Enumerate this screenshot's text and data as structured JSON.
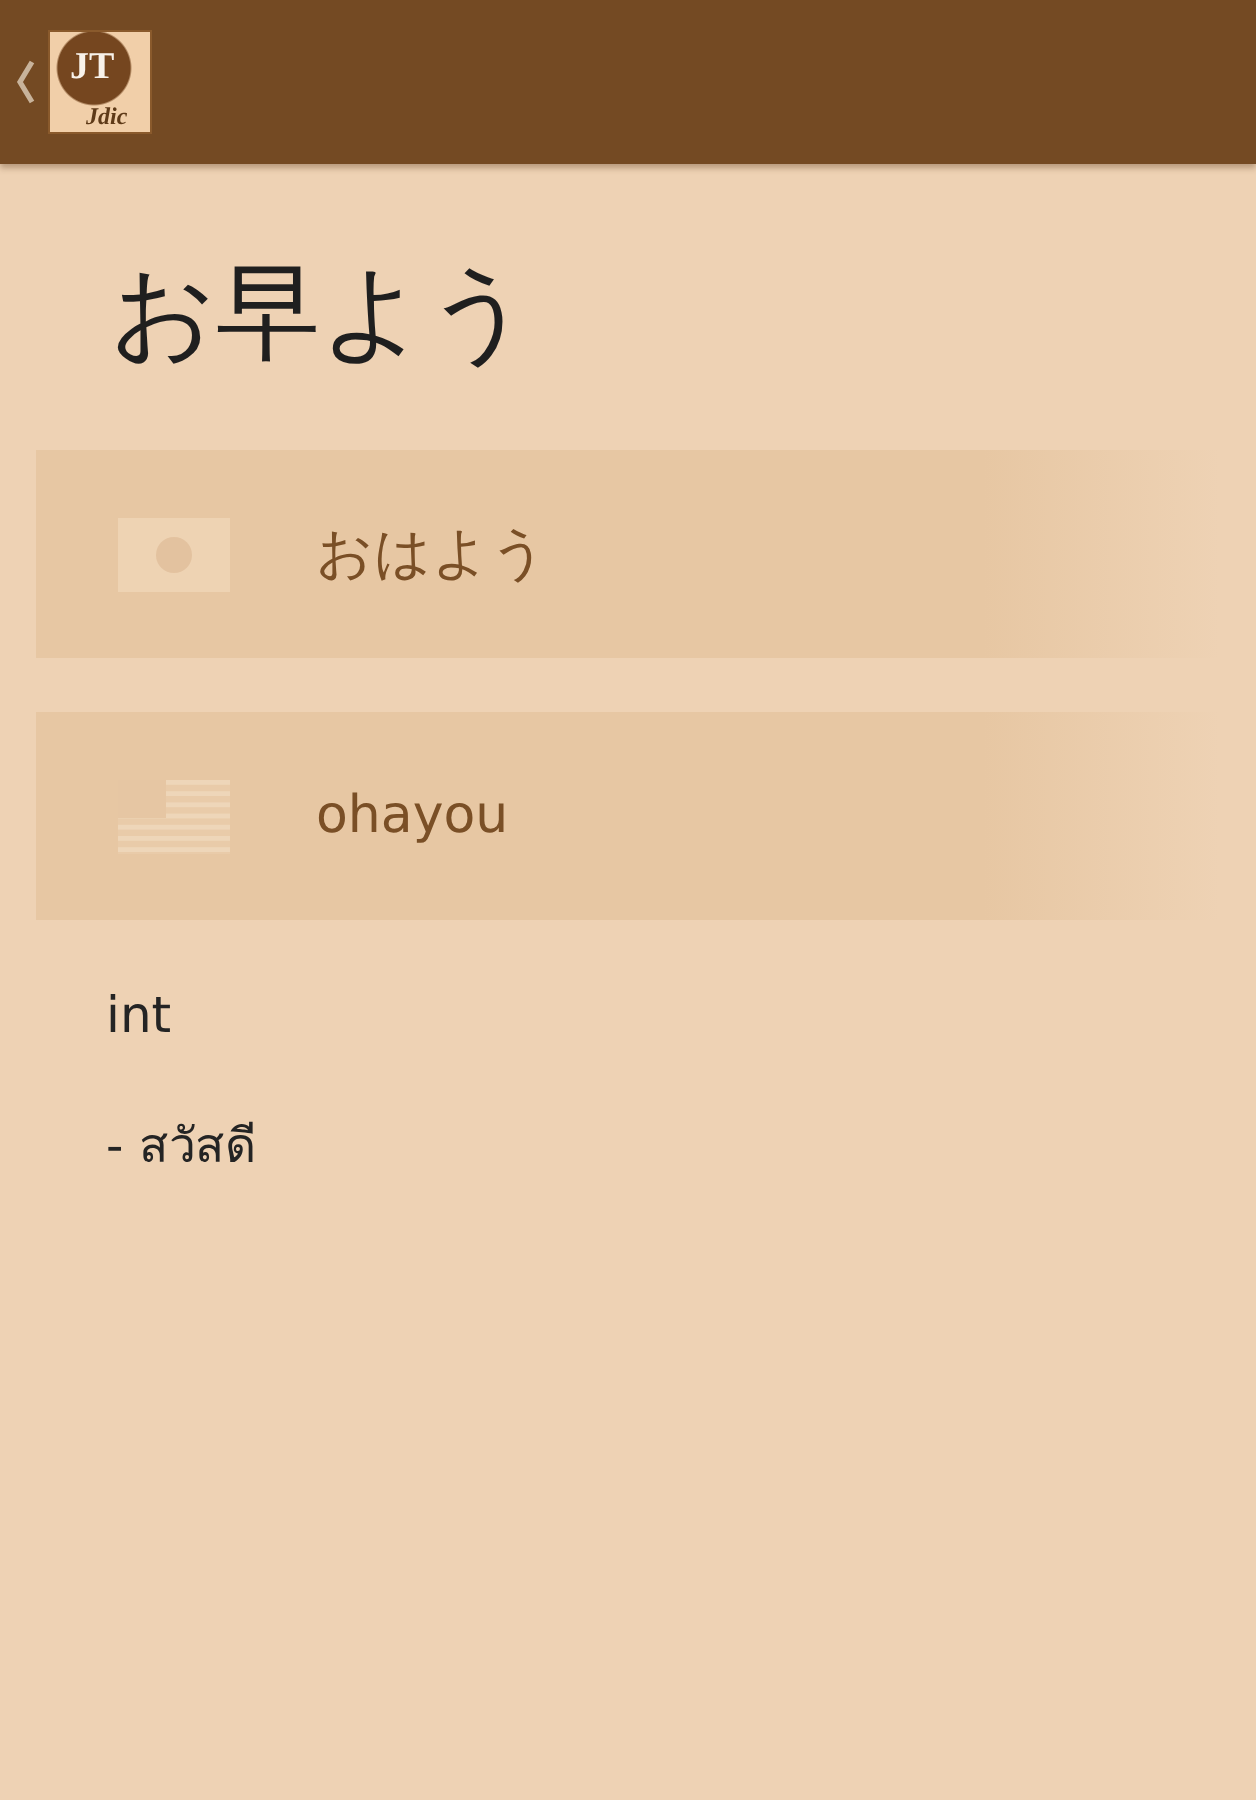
{
  "app_bar": {
    "logo": {
      "main": "JT",
      "sub": "Jdic"
    }
  },
  "headword": "お早よう",
  "readings": [
    {
      "kind": "kana",
      "text": "おはよう"
    },
    {
      "kind": "romaji",
      "text": "ohayou"
    }
  ],
  "part_of_speech": "int",
  "meanings": [
    "- สวัสดี"
  ]
}
